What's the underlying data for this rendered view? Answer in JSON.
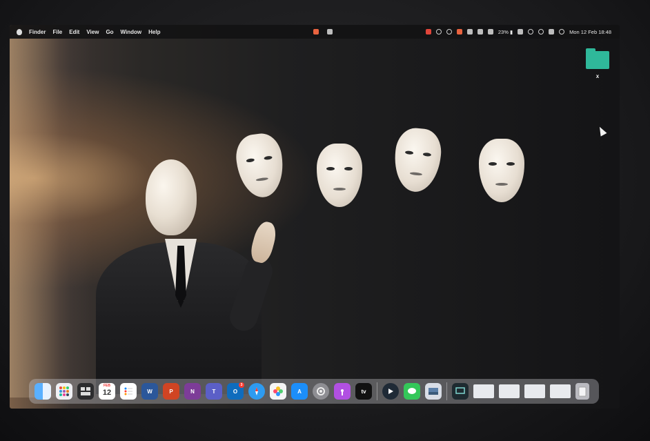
{
  "menubar": {
    "app_menus": [
      "Finder",
      "File",
      "Edit",
      "View",
      "Go",
      "Window",
      "Help"
    ],
    "battery_text": "23% ▮",
    "clock": "Mon 12 Feb  18:48"
  },
  "desktop": {
    "folder_label": "x"
  },
  "dock": {
    "calendar_month": "FEB",
    "calendar_day": "12",
    "outlook_badge": "3",
    "tv_label": "tv",
    "apps": [
      {
        "name": "Finder",
        "icon": "finder-icon",
        "color": "#3a8ef6"
      },
      {
        "name": "Launchpad",
        "icon": "launchpad-icon",
        "color": "#f0f0f4"
      },
      {
        "name": "Mission Control",
        "icon": "mission-control-icon",
        "color": "#2c2c2e"
      },
      {
        "name": "Calendar",
        "icon": "calendar-icon",
        "color": "#ffffff"
      },
      {
        "name": "Reminders",
        "icon": "reminders-icon",
        "color": "#ffffff"
      },
      {
        "name": "Word",
        "icon": "word-icon",
        "color": "#2b579a"
      },
      {
        "name": "PowerPoint",
        "icon": "powerpoint-icon",
        "color": "#d04423"
      },
      {
        "name": "OneNote",
        "icon": "onenote-icon",
        "color": "#7d3c98"
      },
      {
        "name": "Teams",
        "icon": "teams-icon",
        "color": "#5b5fc7"
      },
      {
        "name": "Outlook",
        "icon": "outlook-icon",
        "color": "#0f6cbd"
      },
      {
        "name": "Safari",
        "icon": "safari-icon",
        "color": "#2e9bf0"
      },
      {
        "name": "Photos",
        "icon": "photos-icon",
        "color": "#f5f5f5"
      },
      {
        "name": "App Store",
        "icon": "app-store-icon",
        "color": "#1c8ef9"
      },
      {
        "name": "System Settings",
        "icon": "settings-icon",
        "color": "#8e8e93"
      },
      {
        "name": "Podcasts",
        "icon": "podcasts-icon",
        "color": "#b150e2"
      },
      {
        "name": "TV",
        "icon": "tv-icon",
        "color": "#111111"
      },
      {
        "name": "Prime Video",
        "icon": "prime-video-icon",
        "color": "#1f2a36"
      },
      {
        "name": "Messages",
        "icon": "messages-icon",
        "color": "#34c759"
      },
      {
        "name": "Preview",
        "icon": "preview-icon",
        "color": "#d8dde6"
      }
    ],
    "recent_windows": [
      {
        "icon": "screen-thumb-icon",
        "color": "#1e2a30"
      },
      {
        "icon": "window-thumb-icon",
        "color": "#e8eaee"
      },
      {
        "icon": "window-thumb-icon",
        "color": "#e8eaee"
      },
      {
        "icon": "window-thumb-icon",
        "color": "#e8eaee"
      },
      {
        "icon": "window-thumb-icon",
        "color": "#e8eaee"
      }
    ]
  }
}
